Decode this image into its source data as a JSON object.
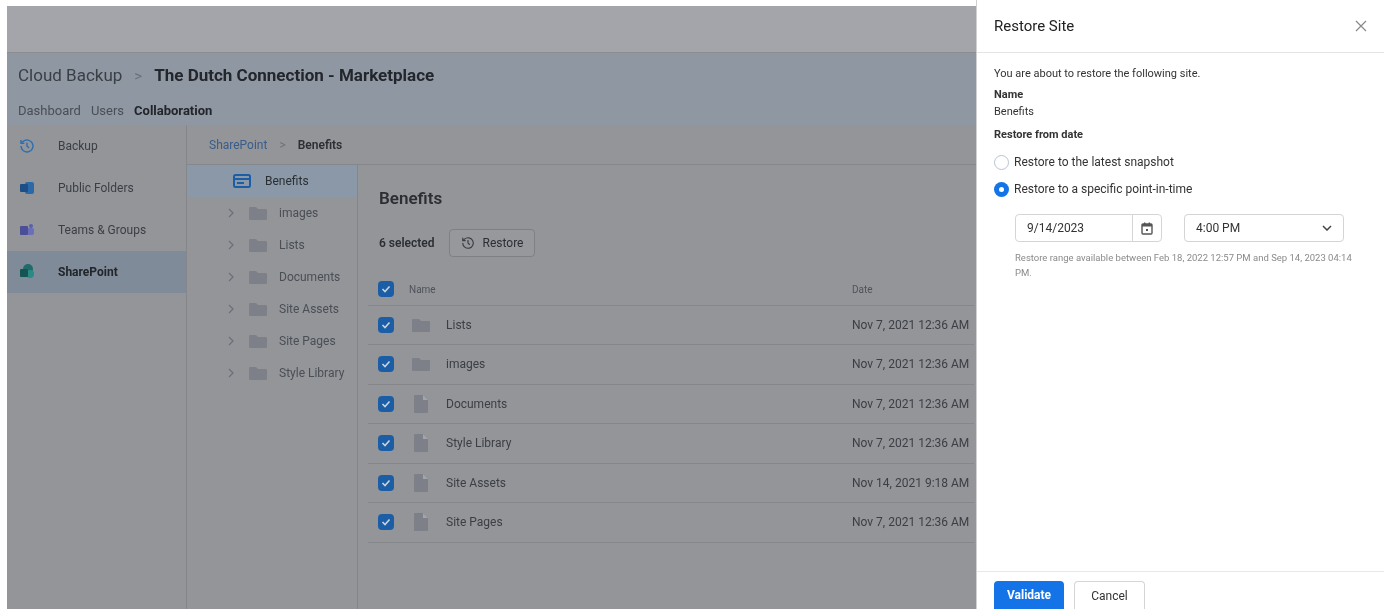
{
  "header": {
    "breadcrumb": [
      "Cloud Backup",
      "The Dutch Connection - Marketplace"
    ],
    "separator": ">"
  },
  "nav_tabs": [
    {
      "label": "Dashboard",
      "selected": false
    },
    {
      "label": "Users",
      "selected": false
    },
    {
      "label": "Collaboration",
      "selected": true
    }
  ],
  "sidebar": {
    "items": [
      {
        "label": "Backup",
        "kind": "history",
        "selected": false
      },
      {
        "label": "Public Folders",
        "kind": "exchange",
        "selected": false
      },
      {
        "label": "Teams & Groups",
        "kind": "teams",
        "selected": false
      },
      {
        "label": "SharePoint",
        "kind": "sharepoint",
        "selected": true
      }
    ]
  },
  "path": {
    "link": "SharePoint",
    "separator": ">",
    "current": "Benefits"
  },
  "tree": {
    "root": {
      "label": "Benefits",
      "selected": true
    },
    "children": [
      {
        "label": "images",
        "expanded": false
      },
      {
        "label": "Lists",
        "expanded": false
      },
      {
        "label": "Documents",
        "expanded": false
      },
      {
        "label": "Site Assets",
        "expanded": false
      },
      {
        "label": "Site Pages",
        "expanded": false
      },
      {
        "label": "Style Library",
        "expanded": false
      }
    ]
  },
  "content": {
    "title": "Benefits",
    "selection_count": "6 selected",
    "restore_button": "Restore"
  },
  "table": {
    "columns": [
      "Name",
      "Date"
    ],
    "all_checked": true,
    "rows": [
      {
        "name": "Lists",
        "kind": "folder",
        "date": "Nov 7, 2021 12:36 AM",
        "checked": true
      },
      {
        "name": "images",
        "kind": "folder",
        "date": "Nov 7, 2021 12:36 AM",
        "checked": true
      },
      {
        "name": "Documents",
        "kind": "file",
        "date": "Nov 7, 2021 12:36 AM",
        "checked": true
      },
      {
        "name": "Style Library",
        "kind": "file",
        "date": "Nov 7, 2021 12:36 AM",
        "checked": true
      },
      {
        "name": "Site Assets",
        "kind": "file",
        "date": "Nov 14, 2021 9:18 AM",
        "checked": true
      },
      {
        "name": "Site Pages",
        "kind": "file",
        "date": "Nov 7, 2021 12:36 AM",
        "checked": true
      }
    ]
  },
  "panel": {
    "title": "Restore Site",
    "intro": "You are about to restore the following site.",
    "name_label": "Name",
    "name_value": "Benefits",
    "date_label": "Restore from date",
    "options": [
      {
        "label": "Restore to the latest snapshot",
        "selected": false
      },
      {
        "label": "Restore to a specific point-in-time",
        "selected": true
      }
    ],
    "date_value": "9/14/2023",
    "time_value": "4:00 PM",
    "hint": "Restore range available between Feb 18, 2022 12:57 PM and Sep 14, 2023 04:14 PM.",
    "buttons": {
      "primary": "Validate",
      "secondary": "Cancel"
    }
  }
}
